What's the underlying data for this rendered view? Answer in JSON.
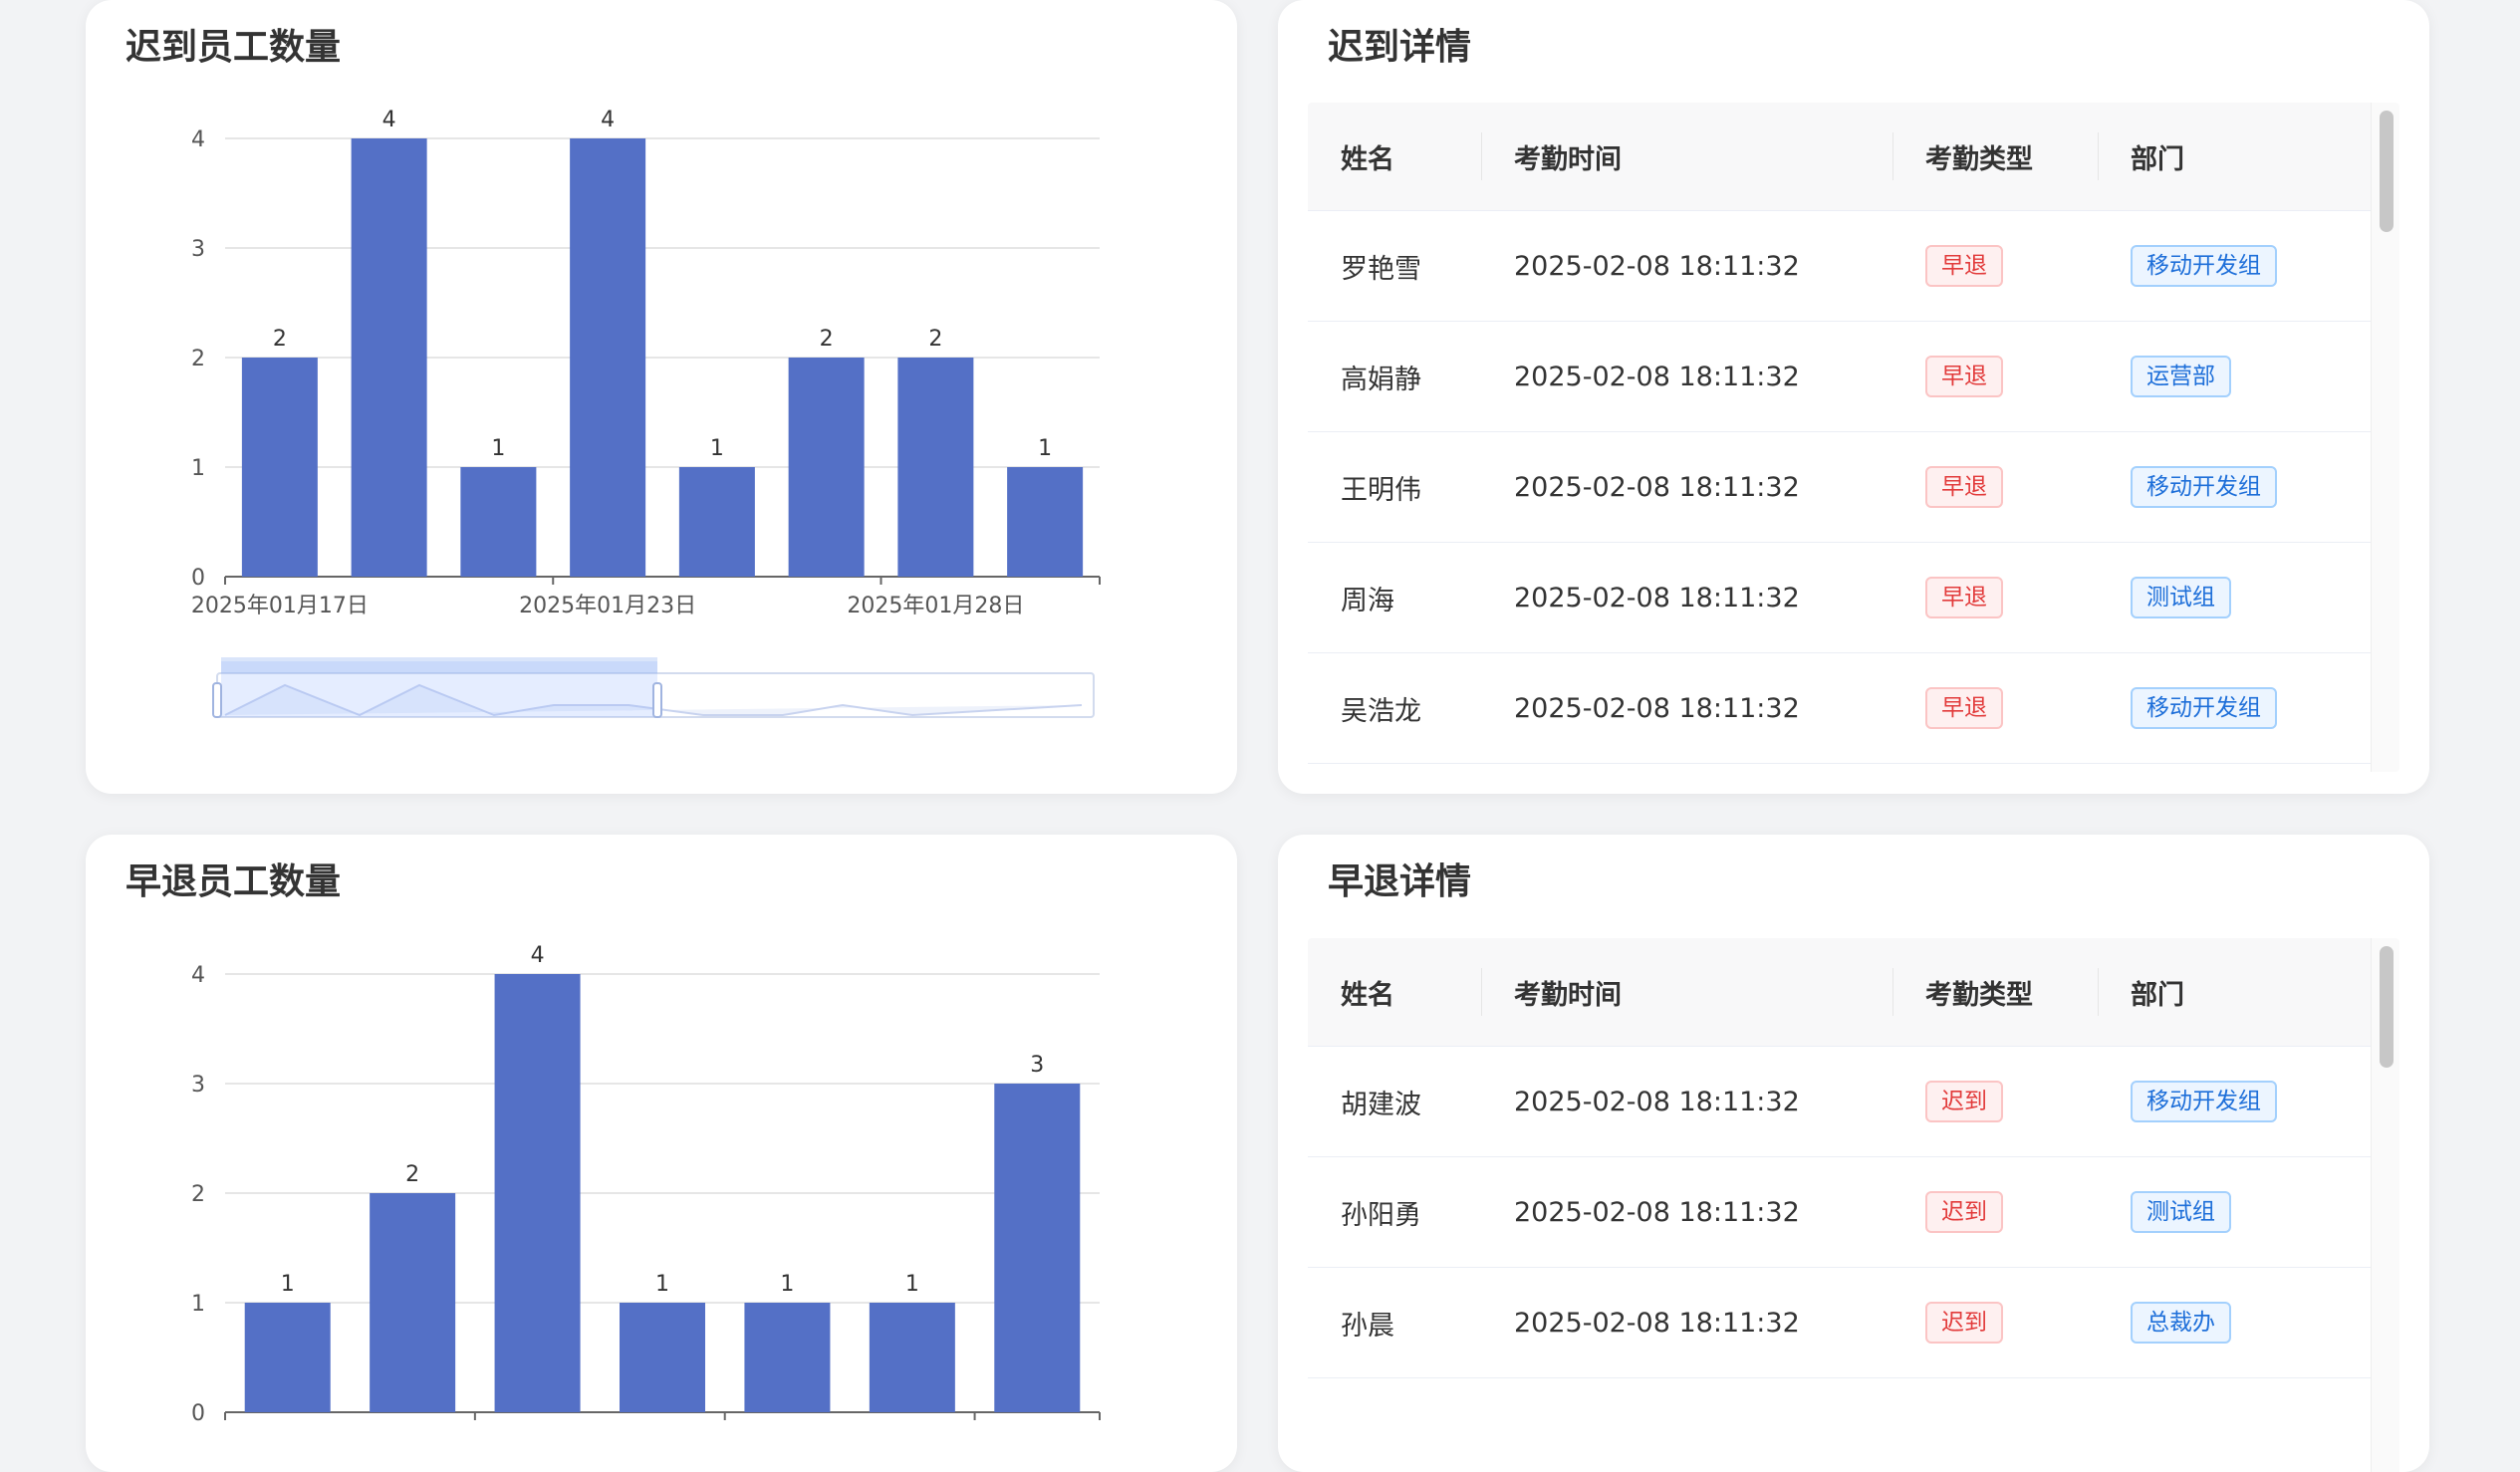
{
  "late_chart_card": {
    "title": "迟到员工数量",
    "chart_data": {
      "type": "bar",
      "title": "",
      "categories": [
        "2025年01月17日",
        "",
        "",
        "2025年01月23日",
        "",
        "",
        "2025年01月28日",
        ""
      ],
      "tick_labels": [
        "2025年01月17日",
        "2025年01月23日",
        "2025年01月28日"
      ],
      "values": [
        2,
        4,
        1,
        4,
        1,
        2,
        2,
        1
      ],
      "ylim": [
        0,
        4
      ],
      "yticks": [
        0,
        1,
        2,
        3,
        4
      ],
      "grid": true,
      "bar_color": "#5470c6",
      "has_data_zoom": true
    }
  },
  "early_chart_card": {
    "title": "早退员工数量",
    "chart_data": {
      "type": "bar",
      "title": "",
      "categories": [
        "",
        "",
        "",
        "",
        "",
        "",
        ""
      ],
      "values": [
        1,
        2,
        4,
        1,
        1,
        1,
        3
      ],
      "ylim": [
        0,
        4
      ],
      "yticks": [
        0,
        1,
        2,
        3,
        4
      ],
      "grid": true,
      "bar_color": "#5470c6"
    }
  },
  "late_detail_card": {
    "title": "迟到详情",
    "columns": [
      "姓名",
      "考勤时间",
      "考勤类型",
      "部门"
    ],
    "rows": [
      {
        "name": "罗艳雪",
        "time": "2025-02-08 18:11:32",
        "type": "早退",
        "dept": "移动开发组"
      },
      {
        "name": "高娟静",
        "time": "2025-02-08 18:11:32",
        "type": "早退",
        "dept": "运营部"
      },
      {
        "name": "王明伟",
        "time": "2025-02-08 18:11:32",
        "type": "早退",
        "dept": "移动开发组"
      },
      {
        "name": "周海",
        "time": "2025-02-08 18:11:32",
        "type": "早退",
        "dept": "测试组"
      },
      {
        "name": "吴浩龙",
        "time": "2025-02-08 18:11:32",
        "type": "早退",
        "dept": "移动开发组"
      }
    ]
  },
  "early_detail_card": {
    "title": "早退详情",
    "columns": [
      "姓名",
      "考勤时间",
      "考勤类型",
      "部门"
    ],
    "rows": [
      {
        "name": "胡建波",
        "time": "2025-02-08 18:11:32",
        "type": "迟到",
        "dept": "移动开发组"
      },
      {
        "name": "孙阳勇",
        "time": "2025-02-08 18:11:32",
        "type": "迟到",
        "dept": "测试组"
      },
      {
        "name": "孙晨",
        "time": "2025-02-08 18:11:32",
        "type": "迟到",
        "dept": "总裁办"
      }
    ]
  },
  "colors": {
    "bar": "#5470c6",
    "tag_red": "#e23b3b",
    "tag_blue": "#1e6fd9"
  }
}
